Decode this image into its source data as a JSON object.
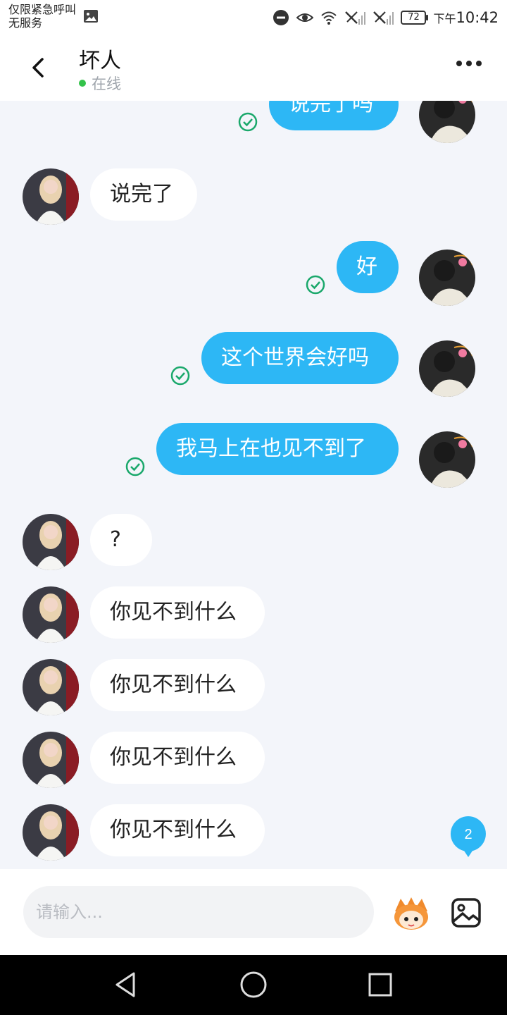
{
  "status_bar": {
    "carrier_line1": "仅限紧急呼叫",
    "carrier_line2": "无服务",
    "battery": "72",
    "time_prefix": "下午",
    "time": "10:42"
  },
  "header": {
    "title": "坏人",
    "status": "在线"
  },
  "messages": [
    {
      "side": "out",
      "text": "说完了吗"
    },
    {
      "side": "in",
      "text": "说完了"
    },
    {
      "side": "out",
      "text": "好"
    },
    {
      "side": "out",
      "text": "这个世界会好吗"
    },
    {
      "side": "out",
      "text": "我马上在也见不到了"
    },
    {
      "side": "in",
      "text": "?"
    },
    {
      "side": "in",
      "text": "你见不到什么"
    },
    {
      "side": "in",
      "text": "你见不到什么"
    },
    {
      "side": "in",
      "text": "你见不到什么"
    },
    {
      "side": "in",
      "text": "你见不到什么"
    }
  ],
  "unread_count": "2",
  "input": {
    "placeholder": "请输入..."
  },
  "colors": {
    "accent": "#2db7f5",
    "check": "#1aa86b",
    "online": "#33c24a",
    "chat_bg": "#f3f5fa"
  },
  "icons": [
    "image-icon",
    "dnd-icon",
    "eye-icon",
    "wifi-icon",
    "no-signal-icon",
    "back-icon",
    "more-icon",
    "check-icon",
    "emoji-icon",
    "gallery-icon",
    "nav-back-icon",
    "nav-home-icon",
    "nav-recent-icon"
  ]
}
